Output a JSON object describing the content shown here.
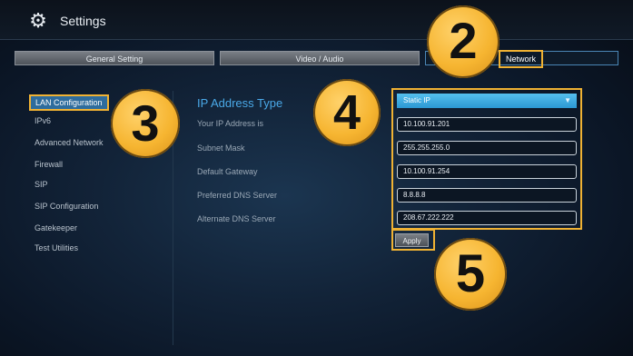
{
  "header": {
    "title": "Settings",
    "icon": "gear-icon"
  },
  "tabs": [
    "General Setting",
    "Video / Audio",
    "Network"
  ],
  "sidebar": {
    "items": [
      {
        "label": "LAN Configuration"
      },
      {
        "label": "IPv6"
      },
      {
        "label": "Advanced Network"
      },
      {
        "label": "Firewall"
      },
      {
        "label": "SIP"
      },
      {
        "label": "SIP Configuration"
      },
      {
        "label": "Gatekeeper"
      },
      {
        "label": "Test Utilities"
      }
    ]
  },
  "form": {
    "section_title": "IP Address Type",
    "ip_type": "Static IP",
    "labels": [
      "Your IP Address is",
      "Subnet Mask",
      "Default Gateway",
      "Preferred DNS Server",
      "Alternate DNS Server"
    ],
    "values": [
      "10.100.91.201",
      "255.255.255.0",
      "10.100.91.254",
      "8.8.8.8",
      "208.67.222.222"
    ],
    "apply_label": "Apply"
  },
  "callouts": [
    "2",
    "3",
    "4",
    "5"
  ],
  "colors": {
    "accent": "#4aa9e8",
    "highlight_border": "#f0b233",
    "select_bg": "#2b97d3"
  }
}
